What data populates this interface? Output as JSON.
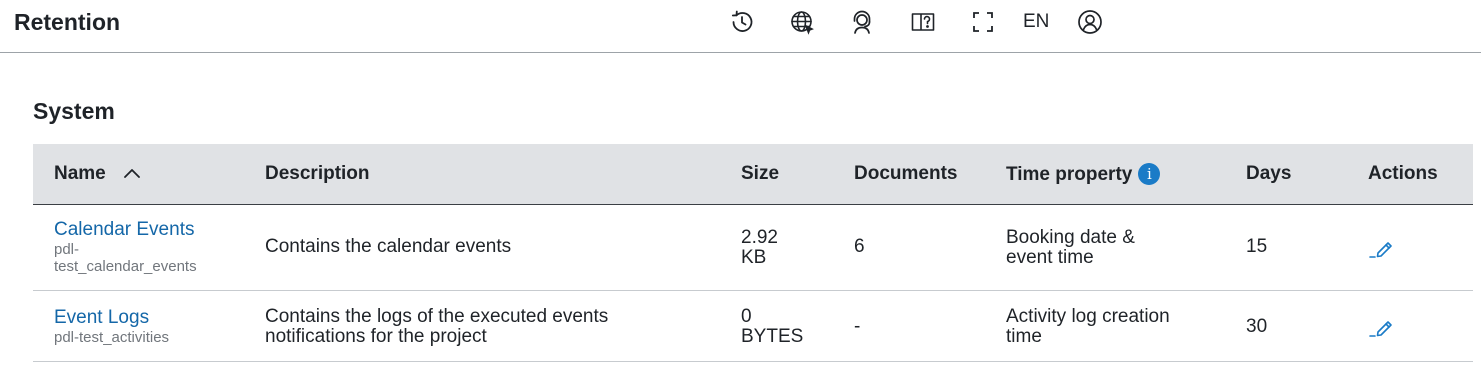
{
  "header": {
    "title": "Retention",
    "icons": [
      "history-icon",
      "globe-icon",
      "support-icon",
      "help-book-icon",
      "fullscreen-icon",
      "user-icon"
    ],
    "language": "EN"
  },
  "section": {
    "title": "System"
  },
  "table": {
    "columns": {
      "name": "Name",
      "description": "Description",
      "size": "Size",
      "documents": "Documents",
      "time_property": "Time property",
      "days": "Days",
      "actions": "Actions"
    },
    "sort": {
      "column": "Name",
      "direction": "ascending"
    },
    "rows": [
      {
        "name": "Calendar Events",
        "id_line1": "pdl-",
        "id_line2": "test_calendar_events",
        "description_line1": "Contains the calendar events",
        "description_line2": "",
        "size_line1": "2.92",
        "size_line2": "KB",
        "documents": "6",
        "time_line1": "Booking date &",
        "time_line2": "event time",
        "days": "15"
      },
      {
        "name": "Event Logs",
        "id_line1": "pdl-test_activities",
        "id_line2": "",
        "description_line1": "Contains the logs of the executed events",
        "description_line2": "notifications for the project",
        "size_line1": "0",
        "size_line2": "BYTES",
        "documents": "-",
        "time_line1": "Activity log creation",
        "time_line2": "time",
        "days": "30"
      }
    ]
  },
  "colors": {
    "link": "#1467a8",
    "header_bg": "#e0e2e5",
    "info": "#1a7bc7",
    "edit": "#1a7bc7"
  }
}
